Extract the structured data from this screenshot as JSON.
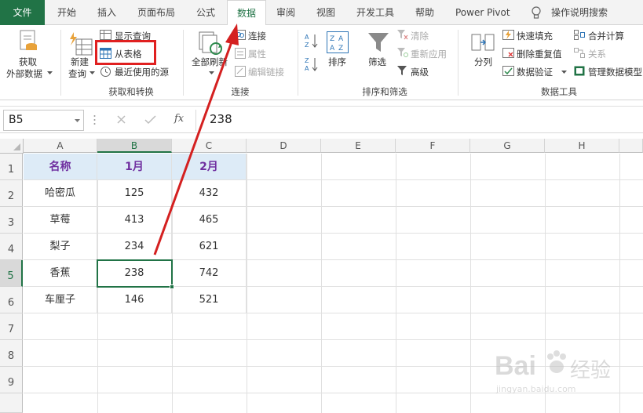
{
  "tabs": [
    "文件",
    "开始",
    "插入",
    "页面布局",
    "公式",
    "数据",
    "审阅",
    "视图",
    "开发工具",
    "帮助",
    "Power Pivot",
    "操作说明搜索"
  ],
  "ribbon": {
    "get_external": [
      "获取",
      "外部数据"
    ],
    "new_query": [
      "新建",
      "查询"
    ],
    "show_queries": "显示查询",
    "from_table": "从表格",
    "recent_sources": "最近使用的源",
    "group_get": "获取和转换",
    "refresh_all": "全部刷新",
    "connections": "连接",
    "properties": "属性",
    "edit_links": "编辑链接",
    "group_conn": "连接",
    "sort": "排序",
    "filter": "筛选",
    "clear": "清除",
    "reapply": "重新应用",
    "advanced": "高级",
    "group_sort": "排序和筛选",
    "split": "分列",
    "flash_fill": "快速填充",
    "remove_dup": "删除重复值",
    "validation": "数据验证",
    "consolidate": "合并计算",
    "relations": "关系",
    "data_model": "管理数据模型",
    "group_tools": "数据工具",
    "sort_az": [
      "A",
      "Z"
    ],
    "sort_za": [
      "Z",
      "A"
    ],
    "fx": "fx"
  },
  "formula": {
    "name_box": "B5",
    "value": "238"
  },
  "columns": [
    "A",
    "B",
    "C",
    "D",
    "E",
    "F",
    "G",
    "H"
  ],
  "rows": [
    "1",
    "2",
    "3",
    "4",
    "5",
    "6",
    "7",
    "8",
    "9"
  ],
  "table": [
    [
      "名称",
      "1月",
      "2月"
    ],
    [
      "哈密瓜",
      "125",
      "432"
    ],
    [
      "草莓",
      "413",
      "465"
    ],
    [
      "梨子",
      "234",
      "621"
    ],
    [
      "香蕉",
      "238",
      "742"
    ],
    [
      "车厘子",
      "146",
      "521"
    ]
  ],
  "watermark": [
    "Bai",
    "经验",
    "jingyan.baidu.com"
  ],
  "colors": {
    "excel_green": "#217346",
    "header_fill": "#ddebf7",
    "header_text": "#7030a0",
    "highlight_box": "#e02020",
    "arrow": "#d42020"
  }
}
